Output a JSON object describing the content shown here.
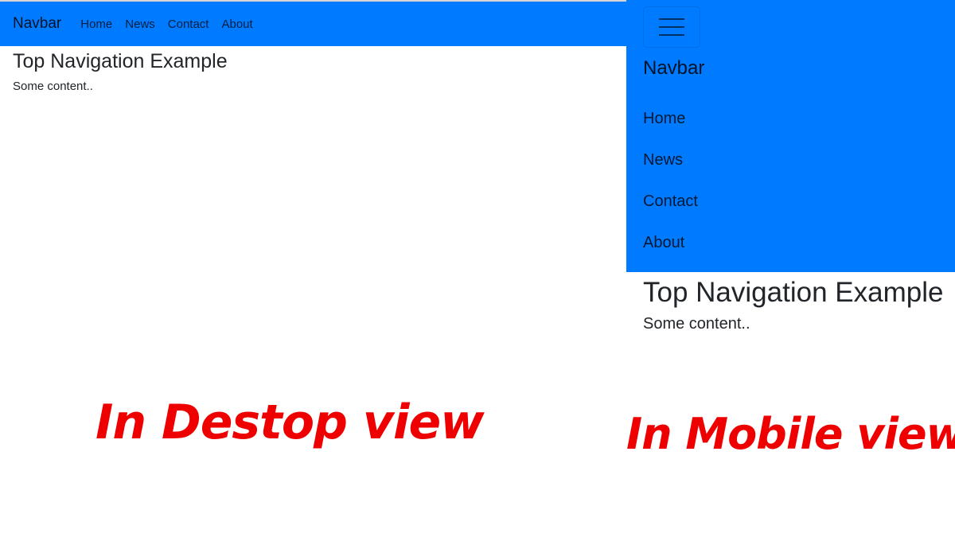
{
  "colors": {
    "navbar_bg": "#007bff",
    "caption": "#ee0000",
    "text": "#212529"
  },
  "desktop": {
    "navbar": {
      "brand": "Navbar",
      "links": [
        "Home",
        "News",
        "Contact",
        "About"
      ]
    },
    "heading": "Top Navigation Example",
    "content": "Some content..",
    "caption": "In Destop view"
  },
  "mobile": {
    "navbar": {
      "toggler_icon": "hamburger-menu-icon",
      "brand": "Navbar",
      "links": [
        "Home",
        "News",
        "Contact",
        "About"
      ]
    },
    "heading": "Top Navigation Example",
    "content": "Some content..",
    "caption": "In Mobile view"
  }
}
